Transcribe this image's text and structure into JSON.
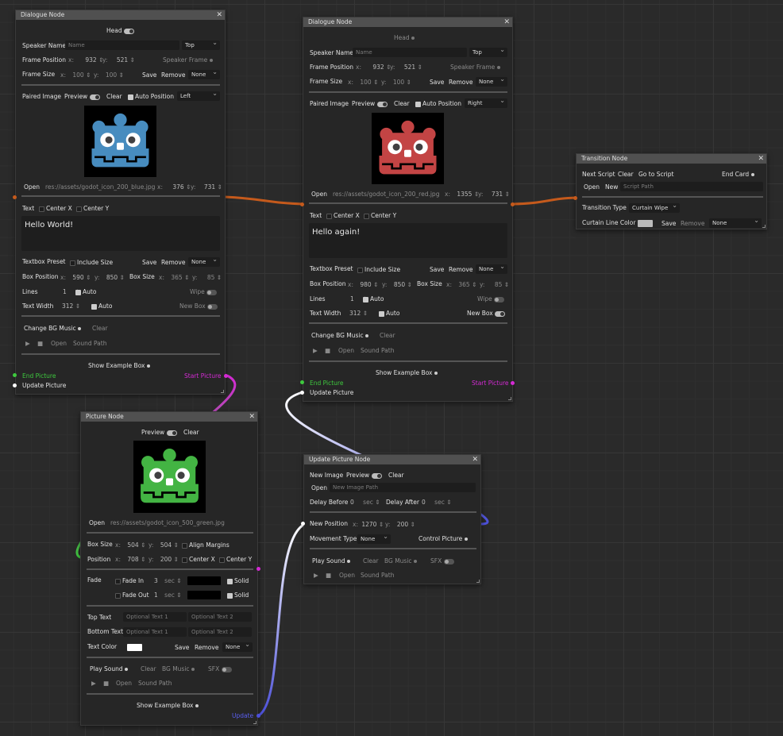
{
  "nodes": {
    "d1": {
      "title": "Dialogue Node",
      "head": "Head",
      "speaker_name": "Speaker Name",
      "speaker_ph": "Name",
      "speaker_pos": "Top",
      "frame_position": "Frame Position",
      "fx": "932",
      "fy": "521",
      "speaker_frame": "Speaker Frame",
      "frame_size": "Frame Size",
      "fsx": "100",
      "fsy": "100",
      "save": "Save",
      "remove": "Remove",
      "none": "None",
      "paired_image": "Paired Image",
      "preview": "Preview",
      "clear": "Clear",
      "auto_position": "Auto Position",
      "align": "Left",
      "open": "Open",
      "path": "res://assets/godot_icon_200_blue.jpg",
      "ix": "376",
      "iy": "731",
      "text": "Text",
      "center_x": "Center X",
      "center_y": "Center Y",
      "dialogue": "Hello World!",
      "textbox_preset": "Textbox Preset",
      "include_size": "Include Size",
      "box_position": "Box Position",
      "bx": "590",
      "by": "850",
      "box_size": "Box Size",
      "bsx": "365",
      "bsy": "85",
      "lines": "Lines",
      "lines_v": "1",
      "auto": "Auto",
      "wipe": "Wipe",
      "text_width": "Text Width",
      "tw": "312",
      "new_box": "New Box",
      "change_bg": "Change BG Music",
      "sound_path": "Sound Path",
      "show_example": "Show Example Box",
      "end_picture": "End Picture",
      "update_picture": "Update Picture",
      "start_picture": "Start Picture"
    },
    "d2": {
      "title": "Dialogue Node",
      "head": "Head",
      "speaker_name": "Speaker Name",
      "speaker_ph": "Name",
      "speaker_pos": "Top",
      "frame_position": "Frame Position",
      "fx": "932",
      "fy": "521",
      "speaker_frame": "Speaker Frame",
      "frame_size": "Frame Size",
      "fsx": "100",
      "fsy": "100",
      "save": "Save",
      "remove": "Remove",
      "none": "None",
      "paired_image": "Paired Image",
      "preview": "Preview",
      "clear": "Clear",
      "auto_position": "Auto Position",
      "align": "Right",
      "open": "Open",
      "path": "res://assets/godot_icon_200_red.jpg",
      "ix": "1355",
      "iy": "731",
      "text": "Text",
      "center_x": "Center X",
      "center_y": "Center Y",
      "dialogue": "Hello again!",
      "textbox_preset": "Textbox Preset",
      "include_size": "Include Size",
      "box_position": "Box Position",
      "bx": "980",
      "by": "850",
      "box_size": "Box Size",
      "bsx": "365",
      "bsy": "85",
      "lines": "Lines",
      "lines_v": "1",
      "auto": "Auto",
      "wipe": "Wipe",
      "text_width": "Text Width",
      "tw": "312",
      "new_box": "New Box",
      "change_bg": "Change BG Music",
      "sound_path": "Sound Path",
      "show_example": "Show Example Box",
      "end_picture": "End Picture",
      "update_picture": "Update Picture",
      "start_picture": "Start Picture"
    },
    "tr": {
      "title": "Transition Node",
      "next_script": "Next Script",
      "clear": "Clear",
      "go_to": "Go to Script",
      "end_card": "End Card",
      "open": "Open",
      "new": "New",
      "script_path": "Script Path",
      "transition_type": "Transition Type",
      "type_v": "Curtain Wipe",
      "curtain_color": "Curtain Line Color",
      "save": "Save",
      "remove": "Remove",
      "none": "None"
    },
    "pic": {
      "title": "Picture Node",
      "preview": "Preview",
      "clear": "Clear",
      "open": "Open",
      "path": "res://assets/godot_icon_500_green.jpg",
      "box_size": "Box Size",
      "bsx": "504",
      "bsy": "504",
      "align_margins": "Align Margins",
      "position": "Position",
      "px": "708",
      "py": "200",
      "center_x": "Center X",
      "center_y": "Center Y",
      "fade": "Fade",
      "fade_in": "Fade In",
      "fade_in_v": "3",
      "sec": "sec",
      "fade_out": "Fade Out",
      "fade_out_v": "1",
      "solid": "Solid",
      "top_text": "Top Text",
      "opt1": "Optional Text 1",
      "opt2": "Optional Text 2",
      "bottom_text": "Bottom Text",
      "text_color": "Text Color",
      "save": "Save",
      "remove": "Remove",
      "none": "None",
      "play_sound": "Play Sound",
      "bg_music": "BG Music",
      "sfx": "SFX",
      "sound_path": "Sound Path",
      "show_example": "Show Example Box",
      "update": "Update"
    },
    "up": {
      "title": "Update Picture Node",
      "new_image": "New Image",
      "preview": "Preview",
      "clear": "Clear",
      "open": "Open",
      "image_path": "New Image Path",
      "delay_before": "Delay Before",
      "db": "0",
      "sec": "sec",
      "delay_after": "Delay After",
      "da": "0",
      "new_position": "New Position",
      "nx": "1270",
      "ny": "200",
      "movement_type": "Movement Type",
      "mt": "None",
      "control_picture": "Control Picture",
      "play_sound": "Play Sound",
      "bg_music": "BG Music",
      "sfx": "SFX",
      "sound_path": "Sound Path"
    }
  },
  "colors": {
    "accent_green": "#3ec93e",
    "accent_magenta": "#d42ad4",
    "accent_orange": "#c55a1c",
    "accent_blue": "#4c50d9",
    "godot_blue": "#478cbf",
    "godot_red": "#c34444",
    "godot_green": "#43b443"
  },
  "icons": [
    "close-icon",
    "toggle-icon",
    "checkbox-icon",
    "dropdown-chevron-icon",
    "play-icon",
    "stop-icon",
    "godot-logo-icon",
    "resize-corner-icon"
  ]
}
